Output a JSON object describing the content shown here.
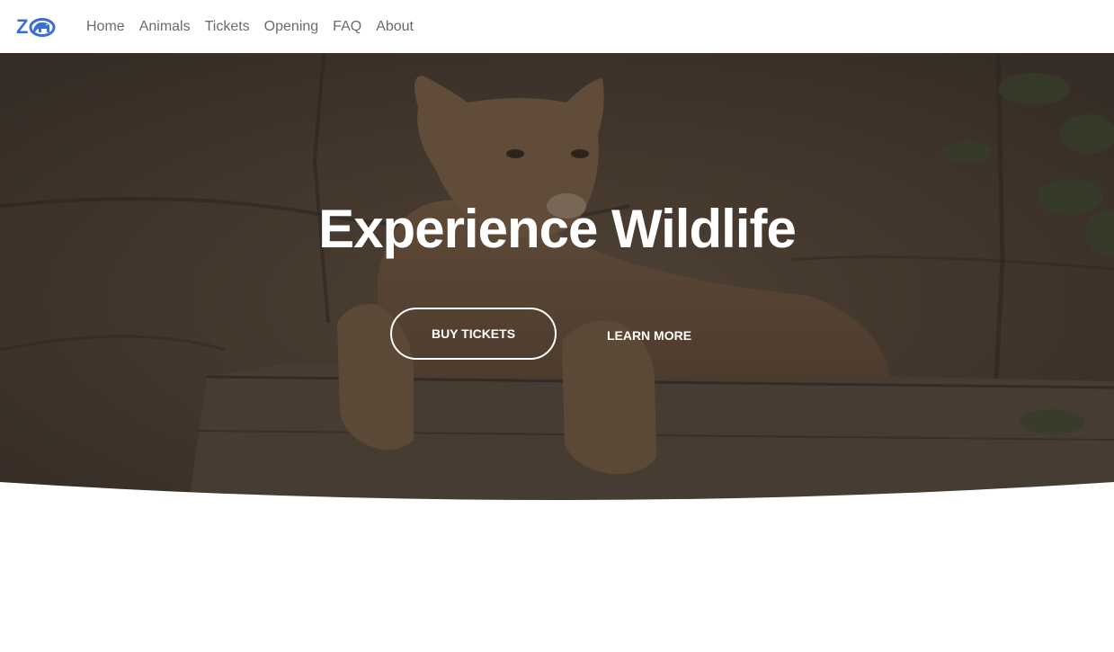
{
  "nav": {
    "logo_text": "ZOO",
    "logo_color": "#3a6fd8",
    "links": [
      {
        "label": "Home"
      },
      {
        "label": "Animals"
      },
      {
        "label": "Tickets"
      },
      {
        "label": "Opening"
      },
      {
        "label": "FAQ"
      },
      {
        "label": "About"
      }
    ]
  },
  "hero": {
    "title": "Experience Wildlife",
    "primary_button": "BUY TICKETS",
    "secondary_button": "LEARN MORE",
    "background_image": "cougar resting on rock ledge"
  },
  "colors": {
    "brand": "#3a6fd8",
    "nav_text": "#6b6b6b",
    "hero_overlay": "#2b241e"
  }
}
